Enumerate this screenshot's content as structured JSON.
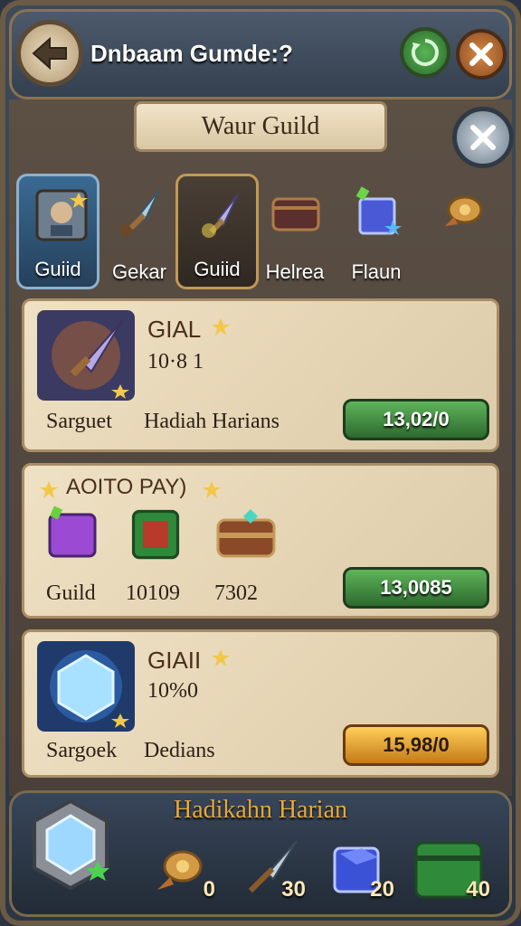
{
  "header": {
    "title": "Dnbaam Gumde:?"
  },
  "banner": {
    "title": "Waur Guild"
  },
  "tabs": [
    {
      "label": "Guiid",
      "icon": "guild-portrait-icon"
    },
    {
      "label": "Gekar",
      "icon": "blade-icon"
    },
    {
      "label": "Guiid",
      "icon": "dagger-icon"
    },
    {
      "label": "Helrea",
      "icon": "chest-icon"
    },
    {
      "label": "Flaun",
      "icon": "crystal-cube-icon"
    },
    {
      "label": "",
      "icon": "horn-icon"
    }
  ],
  "panels": [
    {
      "title": "GIAL",
      "number": "10·8 1",
      "left_label": "Sarguet",
      "desc": "Hadiah Harians",
      "price": "13,02/0",
      "button_color": "green"
    },
    {
      "title": "AOITO PAY)",
      "items": [
        {
          "label": "Guild",
          "icon": "purple-box-icon"
        },
        {
          "label": "10109",
          "icon": "green-box-icon"
        },
        {
          "label": "7302",
          "icon": "treasure-chest-icon"
        }
      ],
      "price": "13,0085",
      "button_color": "green"
    },
    {
      "title": "GIAII",
      "number": "10%0",
      "left_label": "Sargoek",
      "desc": "Dedians",
      "price": "15,98/0",
      "button_color": "gold"
    }
  ],
  "footer": {
    "title": "Hadikahn Harian",
    "rewards": [
      {
        "count": "0",
        "icon": "horn-icon"
      },
      {
        "count": "30",
        "icon": "spear-icon"
      },
      {
        "count": "20",
        "icon": "cube-icon"
      },
      {
        "count": "40",
        "icon": "green-chest-icon"
      }
    ]
  },
  "colors": {
    "accent_green": "#3c8e3c",
    "accent_gold": "#f5b637",
    "parchment": "#e8d7b7",
    "frame": "#34404f"
  }
}
